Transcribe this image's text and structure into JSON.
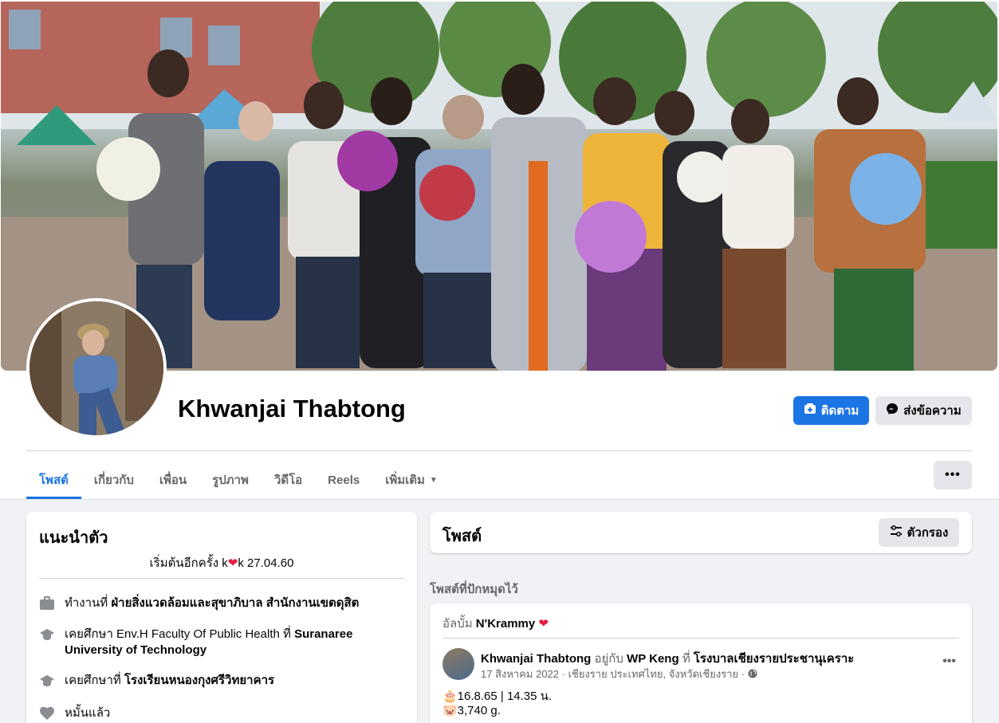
{
  "profile": {
    "name": "Khwanjai Thabtong",
    "follow_label": "ติดตาม",
    "message_label": "ส่งข้อความ"
  },
  "tabs": [
    {
      "label": "โพสต์",
      "active": true
    },
    {
      "label": "เกี่ยวกับ"
    },
    {
      "label": "เพื่อน"
    },
    {
      "label": "รูปภาพ"
    },
    {
      "label": "วิดีโอ"
    },
    {
      "label": "Reels"
    },
    {
      "label": "เพิ่มเติม"
    }
  ],
  "more_label": "•••",
  "intro": {
    "title": "แนะนำตัว",
    "bio_prefix": "เริ่มต้นอีกครั้ง k",
    "bio_heart": "❤",
    "bio_suffix": "k 27.04.60",
    "work_prefix": "ทำงานที่",
    "work_place": "ฝ่ายสิ่งแวดล้อมและสุขาภิบาล สำนักงานเขตดุสิต",
    "edu1_prefix": "เคยศึกษา Env.H Faculty Of Public Health ที่",
    "edu1_place": "Suranaree University of Technology",
    "edu2_prefix": "เคยศึกษาที่",
    "edu2_place": "โรงเรียนหนองกุงศรีวิทยาคาร",
    "relationship": "หมั้นแล้ว"
  },
  "posts": {
    "title": "โพสต์",
    "filter_label": "ตัวกรอง",
    "pinned_label": "โพสต์ที่ปักหมุดไว้",
    "album_prefix": "อัลบั้ม",
    "album_name": "N'Krammy",
    "album_heart": "❤",
    "author": "Khwanjai Thabtong",
    "with_text": "อยู่กับ",
    "with_name": "WP Keng",
    "at_text": "ที่",
    "place": "โรงบาลเชียงรายประชานุเคราะ",
    "meta": "17 สิงหาคม 2022 · เชียงราย ประเทศไทย, จังหวัดเชียงราย ·",
    "line1": "🎂16.8.65 | 14.35 น.",
    "line2": "🐷3,740 g."
  },
  "colors": {
    "accent": "#1b74e4",
    "heart": "#e41e3f"
  }
}
